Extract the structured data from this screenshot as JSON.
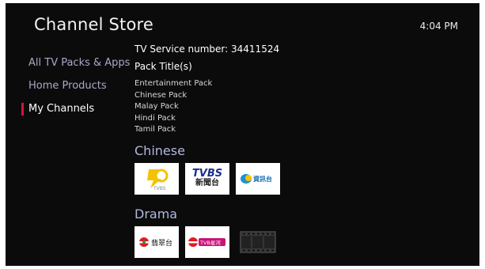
{
  "header": {
    "title": "Channel Store",
    "time": "4:04 PM"
  },
  "nav": {
    "items": [
      {
        "label": "All TV Packs & Apps"
      },
      {
        "label": "Home Products"
      },
      {
        "label": "My Channels"
      }
    ],
    "active_index": 2
  },
  "account": {
    "service_label": "TV Service number:",
    "service_number": "34411524",
    "pack_title_heading": "Pack Title(s)",
    "packs": [
      "Entertainment Pack",
      "Chinese Pack",
      "Malay Pack",
      "Hindi Pack",
      "Tamil Pack"
    ]
  },
  "sections": [
    {
      "name": "Chinese",
      "channels": [
        {
          "icon": "tvbs-asia-logo-icon",
          "logo_text": "TVBS"
        },
        {
          "icon": "tvbs-news-logo-icon",
          "logo_text": "TVBS",
          "logo_subtext": "新聞台"
        },
        {
          "icon": "news-info-channel-logo-icon",
          "logo_text": "資訊台"
        }
      ]
    },
    {
      "name": "Drama",
      "channels": [
        {
          "icon": "jade-channel-logo-icon",
          "logo_text": "翡翠台"
        },
        {
          "icon": "tvb-star-channel-logo-icon",
          "logo_text": "TVB星河"
        },
        {
          "icon": "film-placeholder-icon",
          "logo_text": ""
        }
      ]
    }
  ],
  "colors": {
    "background": "#0b0b0b",
    "accent": "#d0163b",
    "nav_text": "#a9a9c9",
    "section_heading": "#b3b7df"
  }
}
